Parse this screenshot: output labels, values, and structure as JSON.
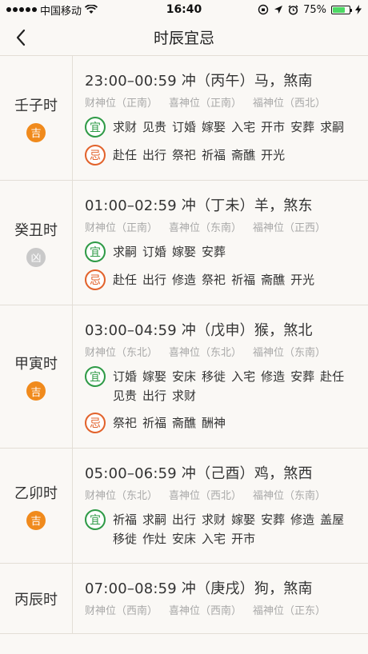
{
  "status_bar": {
    "carrier": "中国移动",
    "time": "16:40",
    "battery": "75%",
    "battery_level": 0.75
  },
  "nav": {
    "title": "时辰宜忌"
  },
  "hours": [
    {
      "name": "壬子时",
      "luck": "吉",
      "luck_type": "good",
      "head": "23:00–00:59 冲（丙午）马，煞南",
      "dirs": [
        "财神位（正南）",
        "喜神位（正南）",
        "福神位（西北）"
      ],
      "yi_label": "宜",
      "yi": [
        "求财",
        "见贵",
        "订婚",
        "嫁娶",
        "入宅",
        "开市",
        "安葬",
        "求嗣"
      ],
      "ji_label": "忌",
      "ji": [
        "赴任",
        "出行",
        "祭祀",
        "祈福",
        "斋醮",
        "开光"
      ]
    },
    {
      "name": "癸丑时",
      "luck": "凶",
      "luck_type": "bad",
      "head": "01:00–02:59 冲（丁未）羊，煞东",
      "dirs": [
        "财神位（正南）",
        "喜神位（东南）",
        "福神位（正西）"
      ],
      "yi_label": "宜",
      "yi": [
        "求嗣",
        "订婚",
        "嫁娶",
        "安葬"
      ],
      "ji_label": "忌",
      "ji": [
        "赴任",
        "出行",
        "修造",
        "祭祀",
        "祈福",
        "斋醮",
        "开光"
      ]
    },
    {
      "name": "甲寅时",
      "luck": "吉",
      "luck_type": "good",
      "head": "03:00–04:59 冲（戊申）猴，煞北",
      "dirs": [
        "财神位（东北）",
        "喜神位（东北）",
        "福神位（东南）"
      ],
      "yi_label": "宜",
      "yi": [
        "订婚",
        "嫁娶",
        "安床",
        "移徙",
        "入宅",
        "修造",
        "安葬",
        "赴任",
        "见贵",
        "出行",
        "求财"
      ],
      "ji_label": "忌",
      "ji": [
        "祭祀",
        "祈福",
        "斋醮",
        "酬神"
      ]
    },
    {
      "name": "乙卯时",
      "luck": "吉",
      "luck_type": "good",
      "head": "05:00–06:59 冲（己酉）鸡，煞西",
      "dirs": [
        "财神位（东北）",
        "喜神位（西北）",
        "福神位（东南）"
      ],
      "yi_label": "宜",
      "yi": [
        "祈福",
        "求嗣",
        "出行",
        "求财",
        "嫁娶",
        "安葬",
        "修造",
        "盖屋",
        "移徙",
        "作灶",
        "安床",
        "入宅",
        "开市"
      ],
      "ji_label": "",
      "ji": []
    },
    {
      "name": "丙辰时",
      "luck": "",
      "luck_type": "good",
      "head": "07:00–08:59 冲（庚戌）狗，煞南",
      "dirs": [
        "财神位（西南）",
        "喜神位（西南）",
        "福神位（正东）"
      ],
      "yi_label": "",
      "yi": [],
      "ji_label": "",
      "ji": []
    }
  ]
}
